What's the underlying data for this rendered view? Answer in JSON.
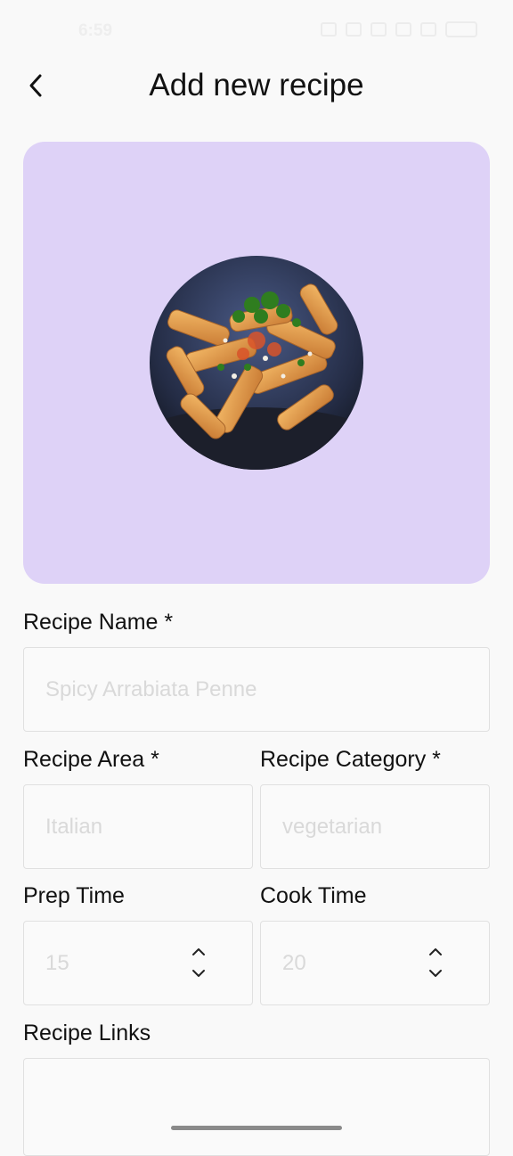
{
  "status_bar": {
    "time": "6:59",
    "icons": [
      "alarm-icon",
      "bluetooth-icon",
      "nfc-icon",
      "wifi-icon",
      "signal-icon",
      "battery-icon"
    ]
  },
  "header": {
    "title": "Add new recipe",
    "back_icon": "chevron-left-icon"
  },
  "image_card": {
    "background_color": "#ded2f7",
    "photo": "penne-pasta-photo"
  },
  "form": {
    "recipe_name": {
      "label": "Recipe Name *",
      "placeholder": "Spicy Arrabiata Penne",
      "value": ""
    },
    "recipe_area": {
      "label": "Recipe Area *",
      "placeholder": "Italian",
      "value": ""
    },
    "recipe_category": {
      "label": "Recipe Category *",
      "placeholder": "vegetarian",
      "value": ""
    },
    "prep_time": {
      "label": "Prep Time",
      "placeholder": "15",
      "value": ""
    },
    "cook_time": {
      "label": "Cook Time",
      "placeholder": "20",
      "value": ""
    },
    "recipe_links": {
      "label": "Recipe Links",
      "placeholder": "",
      "value": ""
    }
  },
  "colors": {
    "background": "#f9f9f9",
    "card": "#ded2f7",
    "field_border": "#e0e0e0",
    "placeholder": "#d9d9d9"
  }
}
